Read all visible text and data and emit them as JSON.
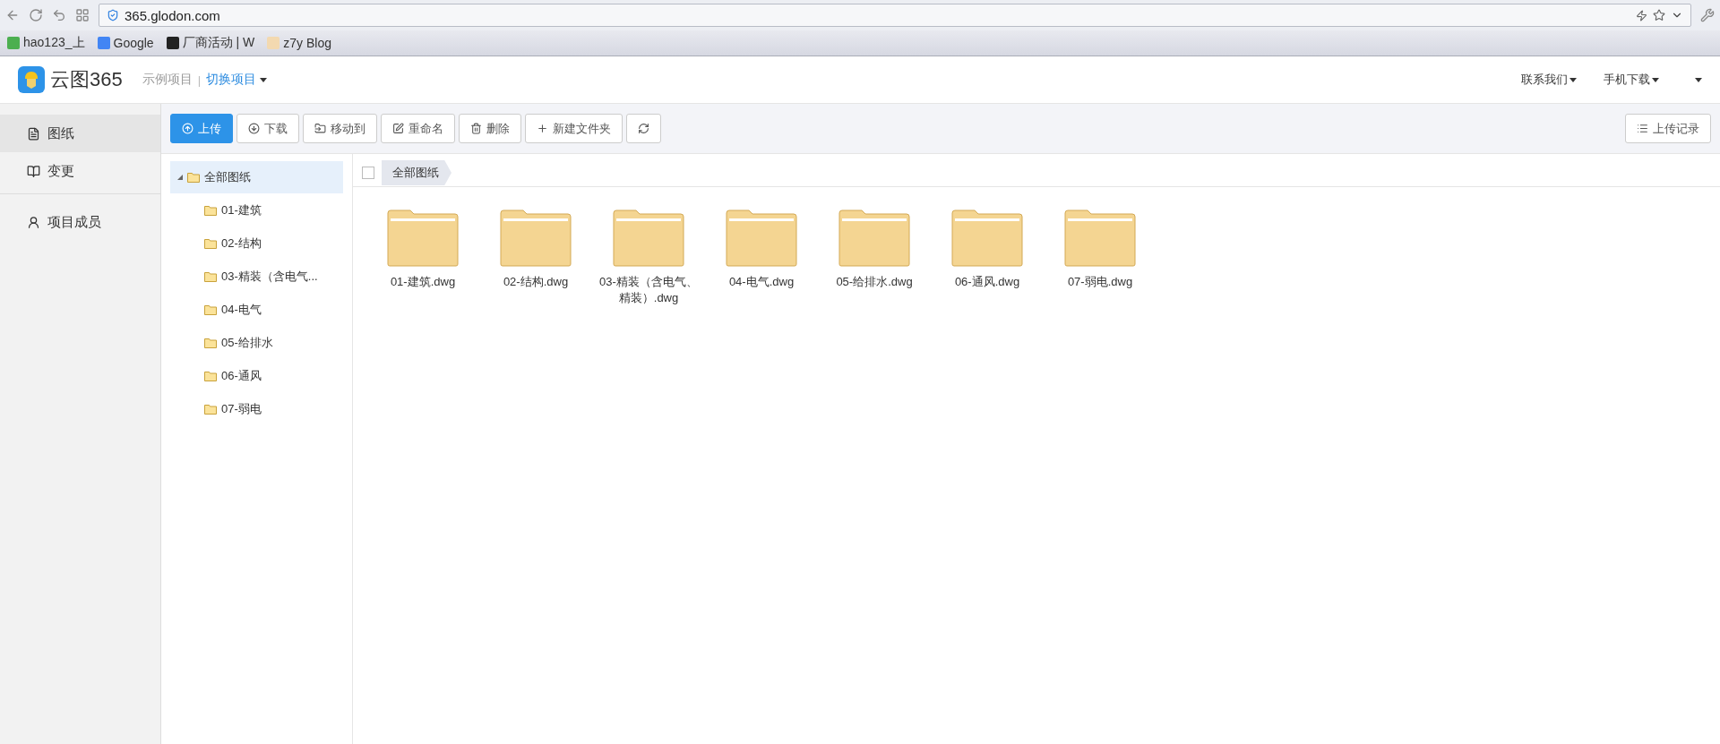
{
  "browser": {
    "address": "365.glodon.com",
    "bookmarks": [
      {
        "label": "hao123_上"
      },
      {
        "label": "Google"
      },
      {
        "label": "厂商活动 | W"
      },
      {
        "label": "z7y Blog"
      }
    ]
  },
  "header": {
    "logo_text": "云图365",
    "project": "示例项目",
    "separator": "|",
    "switch_label": "切换项目",
    "links": [
      "联系我们",
      "手机下载"
    ]
  },
  "nav": [
    {
      "label": "图纸",
      "selected": true
    },
    {
      "label": "变更",
      "selected": false
    },
    {
      "label": "项目成员",
      "selected": false
    }
  ],
  "toolbar": {
    "buttons": [
      {
        "label": "上传",
        "primary": true
      },
      {
        "label": "下载",
        "primary": false
      },
      {
        "label": "移动到",
        "primary": false
      },
      {
        "label": "重命名",
        "primary": false
      },
      {
        "label": "删除",
        "primary": false
      },
      {
        "label": "新建文件夹",
        "primary": false
      }
    ],
    "history": "上传记录"
  },
  "tree": {
    "label": "全部图纸",
    "expanded": true,
    "selected": true,
    "children": [
      {
        "label": "01-建筑"
      },
      {
        "label": "02-结构"
      },
      {
        "label": "03-精装（含电气..."
      },
      {
        "label": "04-电气"
      },
      {
        "label": "05-给排水"
      },
      {
        "label": "06-通风"
      },
      {
        "label": "07-弱电"
      }
    ]
  },
  "breadcrumb": {
    "checked": false,
    "items": [
      "全部图纸"
    ]
  },
  "files": [
    {
      "name": "01-建筑.dwg"
    },
    {
      "name": "02-结构.dwg"
    },
    {
      "name": "03-精装（含电气、精装）.dwg"
    },
    {
      "name": "04-电气.dwg"
    },
    {
      "name": "05-给排水.dwg"
    },
    {
      "name": "06-通风.dwg"
    },
    {
      "name": "07-弱电.dwg"
    }
  ]
}
